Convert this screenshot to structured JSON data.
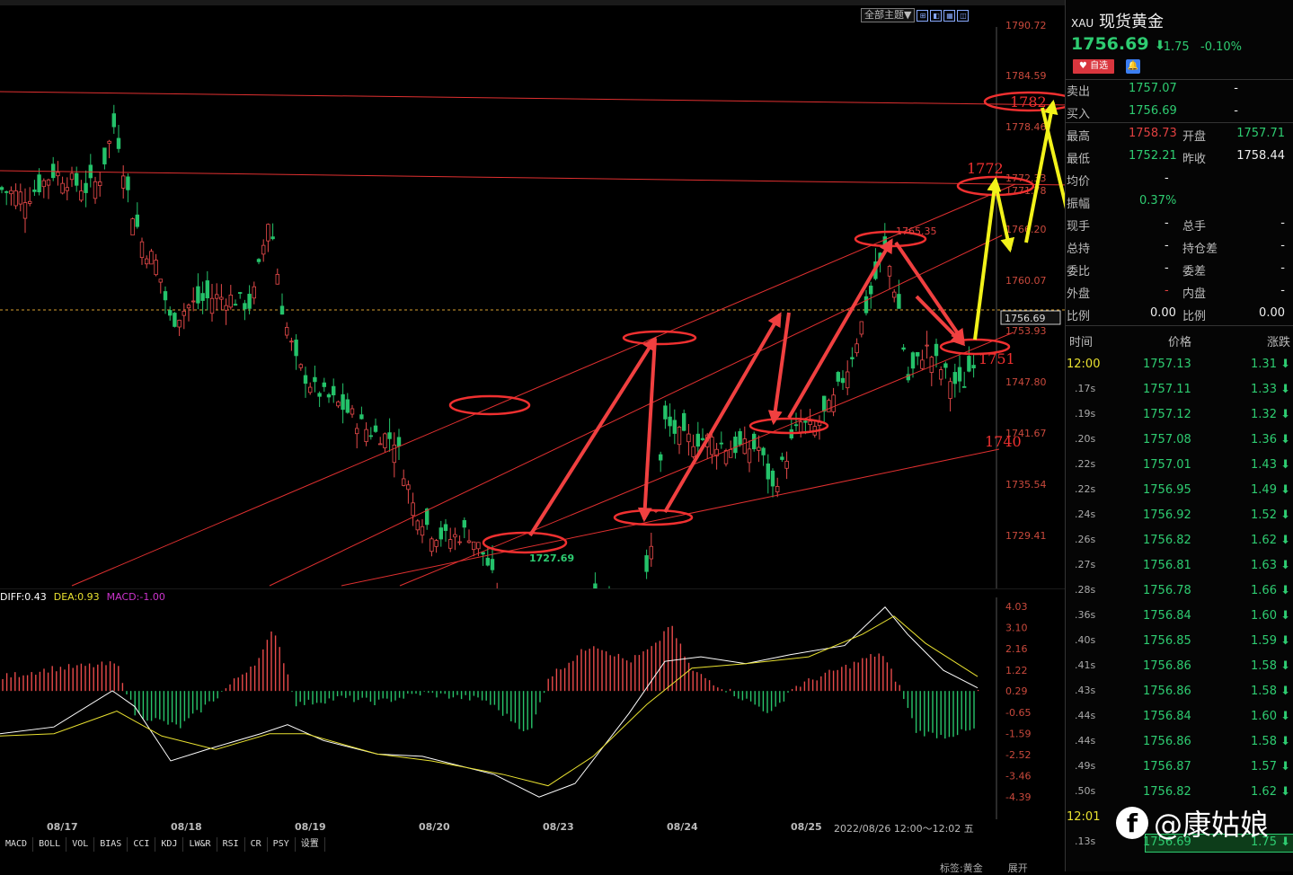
{
  "toolbar": {
    "theme_label": "全部主题▼"
  },
  "chart_data": {
    "type": "candlestick",
    "symbol": "XAU",
    "y_ticks": [
      "1790.72",
      "1784.59",
      "1778.46",
      "1772.33",
      "1771.78",
      "1766.20",
      "1760.07",
      "1753.93",
      "1747.80",
      "1741.67",
      "1735.54",
      "1729.41"
    ],
    "ylim": [
      1726.1,
      1792.6
    ],
    "current_price_tag": "1756.69",
    "high_label": "1765.35",
    "low_label": "1727.69",
    "dates": [
      "08/17",
      "08/18",
      "08/19",
      "08/20",
      "08/23",
      "08/24",
      "08/25"
    ],
    "range_label": "2022/08/26 12:00～12:02 五",
    "annotations": [
      "1782",
      "1772",
      "1751",
      "1740"
    ],
    "indicator": {
      "name": "MACD",
      "legend": [
        {
          "label": "DIFF:0.43",
          "color": "#ffffff"
        },
        {
          "label": "DEA:0.93",
          "color": "#e8e030"
        },
        {
          "label": "MACD:-1.00",
          "color": "#cc33cc"
        }
      ],
      "y_ticks": [
        "4.03",
        "3.10",
        "2.16",
        "1.22",
        "0.29",
        "-0.65",
        "-1.59",
        "-2.52",
        "-3.46",
        "-4.39"
      ],
      "ylim": [
        -4.5,
        4.2
      ]
    }
  },
  "indicator_tabs": [
    "MACD",
    "BOLL",
    "VOL",
    "BIAS",
    "CCI",
    "KDJ",
    "LW&R",
    "RSI",
    "CR",
    "PSY",
    "设置"
  ],
  "panel": {
    "symbol": "XAU",
    "name": "现货黄金",
    "price": "1756.69",
    "arrow": "⬇",
    "change": "-1.75",
    "change_pct": "-0.10%",
    "fav_label": "自选",
    "sell_label": "卖出",
    "sell_val": "1757.07",
    "sell_dash": "-",
    "buy_label": "买入",
    "buy_val": "1756.69",
    "buy_dash": "-",
    "high_label": "最高",
    "high_val": "1758.73",
    "open_label": "开盘",
    "open_val": "1757.71",
    "low_label": "最低",
    "low_val": "1752.21",
    "prev_label": "昨收",
    "prev_val": "1758.44",
    "avg_label": "均价",
    "avg_val": "-",
    "amp_label": "振幅",
    "amp_val": "0.37%",
    "now_label": "现手",
    "now_val": "-",
    "total_label": "总手",
    "total_val": "-",
    "tot2_label": "总持",
    "tot2_val": "-",
    "oi_label": "持仓差",
    "oi_val": "-",
    "bid_label": "委比",
    "bid_val": "-",
    "diff_label": "委差",
    "diff_val": "-",
    "out_label": "外盘",
    "out_val": "-",
    "in_label": "内盘",
    "in_val": "-",
    "ratio_label": "比例",
    "ratio_val": "0.00",
    "ratio2_label": "比例",
    "ratio2_val": "0.00"
  },
  "ticks_header": {
    "time": "时间",
    "price": "价格",
    "change": "涨跌"
  },
  "ticks": [
    {
      "time": "12:00",
      "price": "1757.13",
      "change": "1.31"
    },
    {
      "time": ".17s",
      "price": "1757.11",
      "change": "1.33"
    },
    {
      "time": ".19s",
      "price": "1757.12",
      "change": "1.32"
    },
    {
      "time": ".20s",
      "price": "1757.08",
      "change": "1.36"
    },
    {
      "time": ".22s",
      "price": "1757.01",
      "change": "1.43"
    },
    {
      "time": ".22s",
      "price": "1756.95",
      "change": "1.49"
    },
    {
      "time": ".24s",
      "price": "1756.92",
      "change": "1.52"
    },
    {
      "time": ".26s",
      "price": "1756.82",
      "change": "1.62"
    },
    {
      "time": ".27s",
      "price": "1756.81",
      "change": "1.63"
    },
    {
      "time": ".28s",
      "price": "1756.78",
      "change": "1.66"
    },
    {
      "time": ".36s",
      "price": "1756.84",
      "change": "1.60"
    },
    {
      "time": ".40s",
      "price": "1756.85",
      "change": "1.59"
    },
    {
      "time": ".41s",
      "price": "1756.86",
      "change": "1.58"
    },
    {
      "time": ".43s",
      "price": "1756.86",
      "change": "1.58"
    },
    {
      "time": ".44s",
      "price": "1756.84",
      "change": "1.60"
    },
    {
      "time": ".44s",
      "price": "1756.86",
      "change": "1.58"
    },
    {
      "time": ".49s",
      "price": "1756.87",
      "change": "1.57"
    },
    {
      "time": ".50s",
      "price": "1756.82",
      "change": "1.62"
    },
    {
      "time": "12:01",
      "price": "",
      "change": ""
    },
    {
      "time": ".13s",
      "price": "1756.69",
      "change": "1.75"
    }
  ],
  "watermark": "@康姑娘",
  "status": {
    "tag": "标签:黄金",
    "expand": "展开"
  }
}
